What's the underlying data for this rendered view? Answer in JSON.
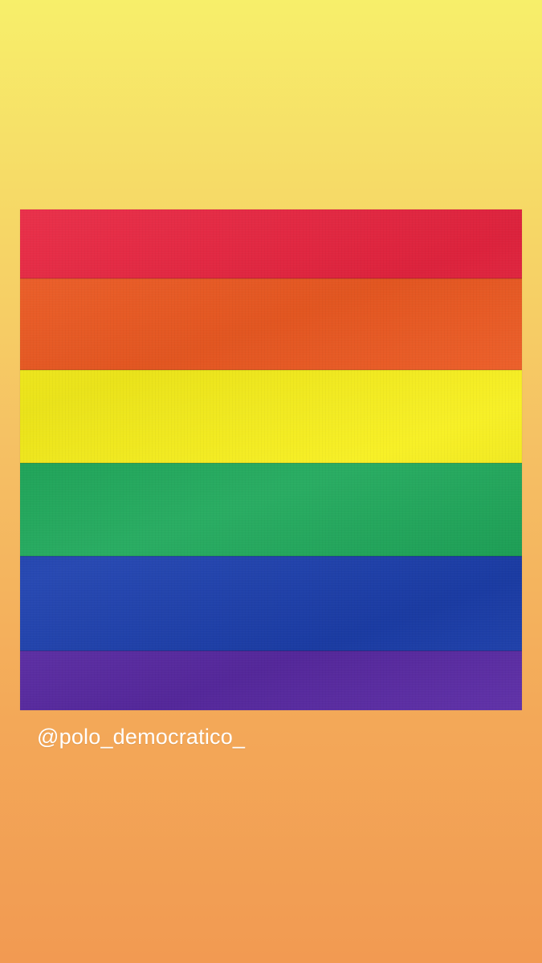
{
  "story": {
    "mention": "@polo_democratico_",
    "background_gradient": [
      "#f7ef6a",
      "#f6d566",
      "#f5bd63",
      "#f3a858",
      "#f29a52"
    ]
  },
  "flag": {
    "stripes": [
      {
        "name": "red",
        "color": "#e8243f"
      },
      {
        "name": "orange",
        "color": "#ee5a22"
      },
      {
        "name": "yellow",
        "color": "#f7ef1b"
      },
      {
        "name": "green",
        "color": "#1ea85a"
      },
      {
        "name": "blue",
        "color": "#1c3fae"
      },
      {
        "name": "purple",
        "color": "#5a2aa5"
      }
    ]
  }
}
